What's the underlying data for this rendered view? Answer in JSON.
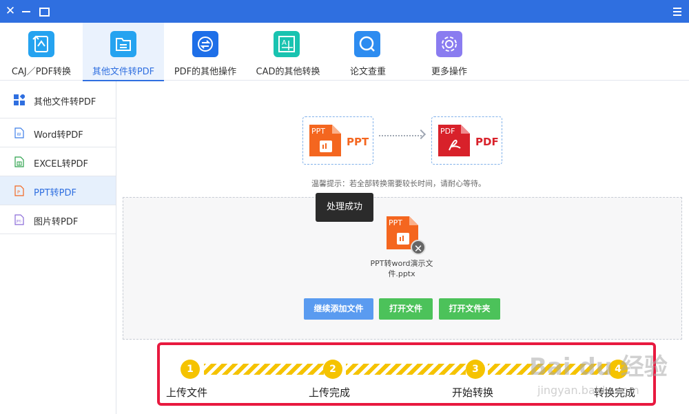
{
  "window": {
    "controls": [
      "close-icon",
      "minimize-icon",
      "maximize-icon",
      "menu-icon"
    ]
  },
  "toolbar": {
    "items": [
      {
        "label": "CAJ／PDF转换",
        "icon": "caj-pdf-convert-icon",
        "color": "#25a3f0"
      },
      {
        "label": "其他文件转PDF",
        "icon": "folder-file-icon",
        "color": "#25a3f0",
        "active": true
      },
      {
        "label": "PDF的其他操作",
        "icon": "pdf-exchange-icon",
        "color": "#1e6fe8"
      },
      {
        "label": "CAD的其他转换",
        "icon": "cad-drawing-icon",
        "color": "#19c3b0"
      },
      {
        "label": "论文查重",
        "icon": "search-document-icon",
        "color": "#2d8cf0"
      },
      {
        "label": "更多操作",
        "icon": "gear-icon",
        "color": "#8a7cf0"
      }
    ]
  },
  "sidebar": {
    "items": [
      {
        "label": "其他文件转PDF",
        "icon": "grid-apps-icon"
      },
      {
        "label": "Word转PDF",
        "icon": "word-file-icon"
      },
      {
        "label": "EXCEL转PDF",
        "icon": "excel-file-icon"
      },
      {
        "label": "PPT转PDF",
        "icon": "ppt-file-icon",
        "active": true
      },
      {
        "label": "图片转PDF",
        "icon": "image-file-icon"
      }
    ]
  },
  "conversion": {
    "source_badge": "PPT",
    "source_label": "PPT",
    "target_badge": "PDF",
    "target_label": "PDF",
    "tip": "温馨提示：若全部转换需要较长时间，请耐心等待。"
  },
  "file": {
    "badge": "PPT",
    "name": "PPT转word演示文件.pptx",
    "status_tooltip": "处理成功"
  },
  "actions": {
    "continue_add": "继续添加文件",
    "open_file": "打开文件",
    "open_folder": "打开文件夹"
  },
  "steps": [
    {
      "number": "1",
      "label": "上传文件"
    },
    {
      "number": "2",
      "label": "上传完成"
    },
    {
      "number": "3",
      "label": "开始转换"
    },
    {
      "number": "4",
      "label": "转换完成"
    }
  ],
  "watermark": {
    "text": "Bai du 经验",
    "sub": "jingyan.baidu.com"
  },
  "colors": {
    "titlebar": "#2f6fe0",
    "accent": "#2f6fe0",
    "ppt_orange": "#f4661f",
    "pdf_red": "#d8212a",
    "step_yellow": "#f5c300",
    "highlight_red": "#e8193f",
    "green": "#4cc25a",
    "blue_button": "#5a9bf0"
  }
}
